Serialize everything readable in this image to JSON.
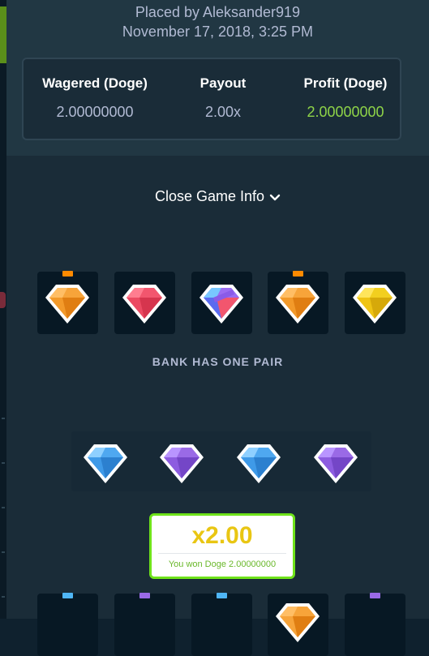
{
  "header": {
    "placed_by": "Placed by Aleksander919",
    "timestamp": "November 17, 2018, 3:25 PM"
  },
  "stats": {
    "wagered_label": "Wagered (Doge)",
    "wagered_value": "2.00000000",
    "payout_label": "Payout",
    "payout_value": "2.00x",
    "profit_label": "Profit (Doge)",
    "profit_value": "2.00000000",
    "profit_color": "#8fd448"
  },
  "game_info_toggle": {
    "label": "Close Game Info",
    "icon": "chevron-down-icon"
  },
  "bank": {
    "result_label": "BANK HAS ONE PAIR",
    "gems": [
      {
        "color": "orange",
        "marker": "orange"
      },
      {
        "color": "red",
        "marker": null
      },
      {
        "color": "multicolor",
        "marker": null
      },
      {
        "color": "orange",
        "marker": "orange"
      },
      {
        "color": "yellow",
        "marker": null
      }
    ]
  },
  "player": {
    "gems": [
      "blue",
      "purple",
      "blue",
      "purple"
    ]
  },
  "win": {
    "multiplier": "x2.00",
    "message": "You won Doge 2.00000000"
  },
  "bottom_row": {
    "markers": [
      "blue",
      "purple",
      "blue",
      null,
      "purple"
    ]
  },
  "colors": {
    "background": "#0f212e",
    "panel": "#1a2c38",
    "header": "#213743",
    "win_border": "#6fe31a",
    "multiplier": "#e9c613"
  }
}
